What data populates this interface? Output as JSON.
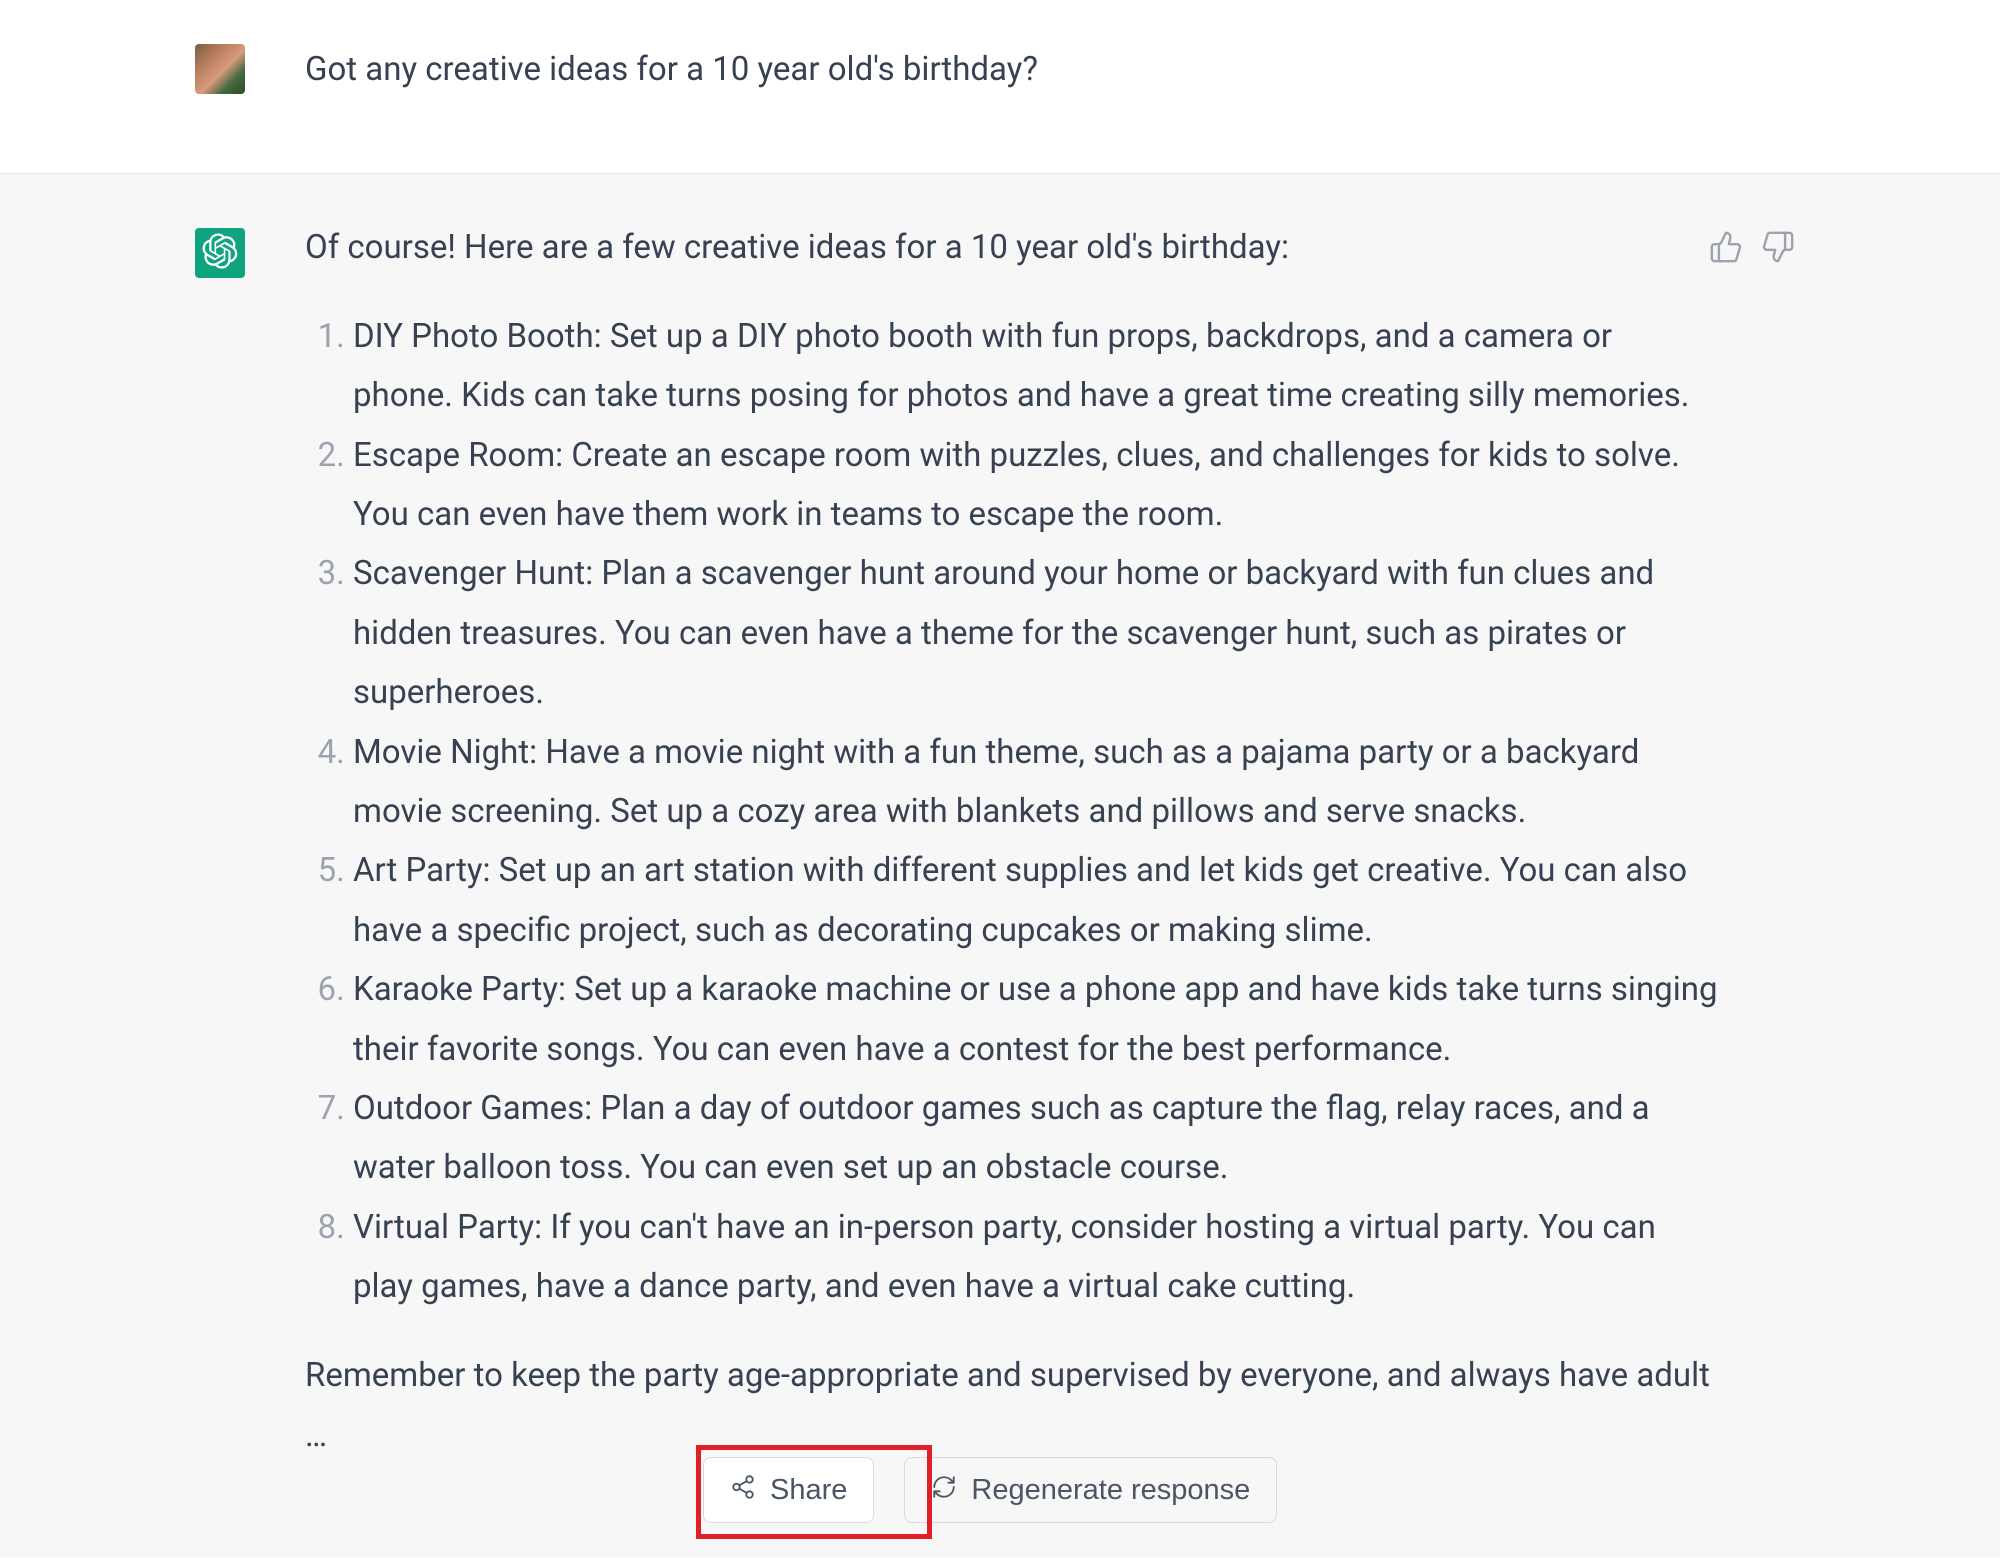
{
  "user": {
    "message": "Got any creative ideas for a 10 year old's birthday?"
  },
  "assistant": {
    "intro": "Of course! Here are a few creative ideas for a 10 year old's birthday:",
    "ideas": [
      "DIY Photo Booth: Set up a DIY photo booth with fun props, backdrops, and a camera or phone. Kids can take turns posing for photos and have a great time creating silly memories.",
      "Escape Room: Create an escape room with puzzles, clues, and challenges for kids to solve. You can even have them work in teams to escape the room.",
      "Scavenger Hunt: Plan a scavenger hunt around your home or backyard with fun clues and hidden treasures. You can even have a theme for the scavenger hunt, such as pirates or superheroes.",
      "Movie Night: Have a movie night with a fun theme, such as a pajama party or a backyard movie screening. Set up a cozy area with blankets and pillows and serve snacks.",
      "Art Party: Set up an art station with different supplies and let kids get creative. You can also have a specific project, such as decorating cupcakes or making slime.",
      "Karaoke Party: Set up a karaoke machine or use a phone app and have kids take turns singing their favorite songs. You can even have a contest for the best performance.",
      "Outdoor Games: Plan a day of outdoor games such as capture the flag, relay races, and a water balloon toss. You can even set up an obstacle course.",
      "Virtual Party: If you can't have an in-person party, consider hosting a virtual party. You can play games, have a dance party, and even have a virtual cake cutting."
    ],
    "closing": "Remember to keep the party age-appropriate and supervised by everyone, and always have adult …"
  },
  "actions": {
    "share": "Share",
    "regenerate": "Regenerate response"
  }
}
